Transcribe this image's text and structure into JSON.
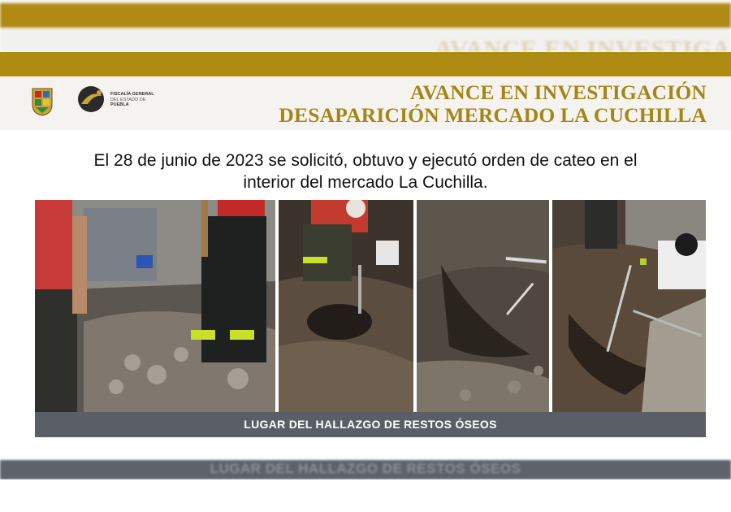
{
  "header": {
    "title_line1": "AVANCE EN INVESTIGACIÓN",
    "title_line2": "DESAPARICIÓN MERCADO LA CUCHILLA",
    "ghost_title": "AVANCE EN INVESTIGA",
    "logo": {
      "line1": "FISCALÍA GENERAL",
      "line2": "DEL ESTADO DE",
      "line3": "PUEBLA"
    }
  },
  "caption": {
    "line1": "El 28 de junio de 2023 se solicitó, obtuvo y ejecutó orden de cateo  en el",
    "line2": "interior del mercado La Cuchilla."
  },
  "photo_strip": {
    "label": "LUGAR DEL HALLAZGO DE RESTOS ÓSEOS",
    "ghost_label": "LUGAR DEL HALLAZGO DE RESTOS ÓSEOS"
  },
  "colors": {
    "gold": "#ae8b12",
    "title_gold": "#a48516",
    "label_bar": "#5a5e66"
  }
}
